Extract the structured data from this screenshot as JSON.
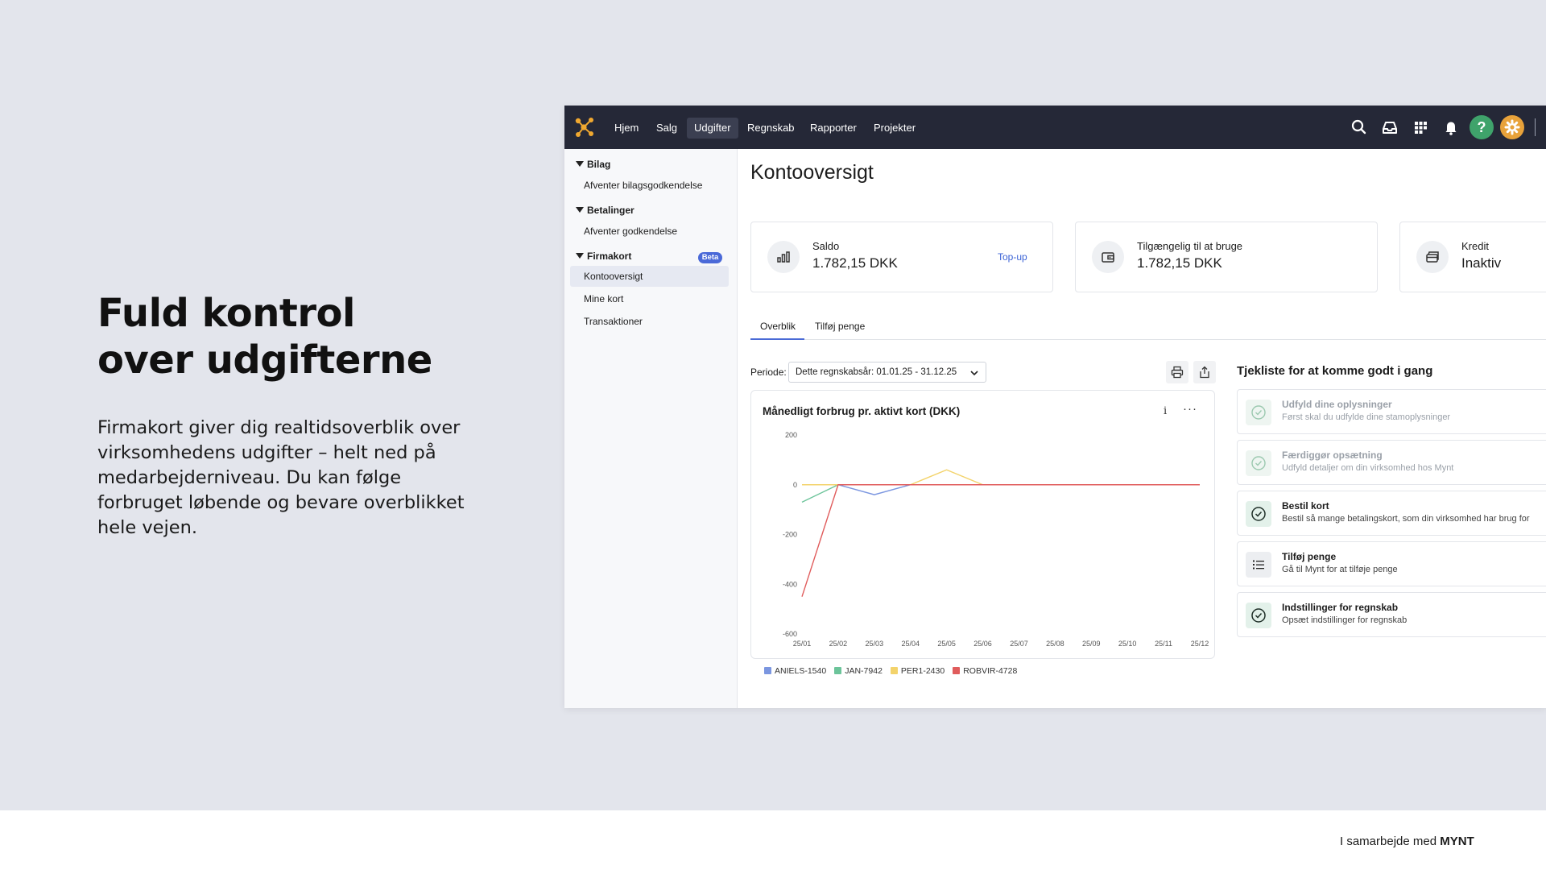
{
  "hero": {
    "title_line1": "Fuld kontrol",
    "title_line2": "over udgifterne",
    "text": "Firmakort giver dig realtidsoverblik over virksomhedens udgifter – helt ned på medarbejderniveau. Du kan følge forbruget løbende og bevare overblikket hele vejen."
  },
  "footer": {
    "prefix": "I samarbejde med",
    "brand": "MYNT"
  },
  "nav": {
    "items": [
      {
        "label": "Hjem",
        "active": false
      },
      {
        "label": "Salg",
        "active": false
      },
      {
        "label": "Udgifter",
        "active": true
      },
      {
        "label": "Regnskab",
        "active": false
      },
      {
        "label": "Rapporter",
        "active": false
      },
      {
        "label": "Projekter",
        "active": false
      }
    ],
    "icons": [
      "search-icon",
      "inbox-icon",
      "apps-grid-icon",
      "bell-icon",
      "help-icon",
      "settings-icon"
    ],
    "colors": {
      "bg": "#252837",
      "help": "#3fa36b",
      "settings": "#e8a23a",
      "logo": "#f0a830"
    }
  },
  "sidebar": {
    "sections": [
      {
        "label": "Bilag",
        "items": [
          "Afventer bilagsgodkendelse"
        ]
      },
      {
        "label": "Betalinger",
        "items": [
          "Afventer godkendelse"
        ]
      },
      {
        "label": "Firmakort",
        "badge": "Beta",
        "items": [
          "Kontooversigt",
          "Mine kort",
          "Transaktioner"
        ],
        "active_item": "Kontooversigt"
      }
    ]
  },
  "main": {
    "title": "Kontooversigt",
    "cards": [
      {
        "label": "Saldo",
        "value": "1.782,15 DKK",
        "link": "Top-up",
        "icon": "bar-chart-icon"
      },
      {
        "label": "Tilgængelig til at bruge",
        "value": "1.782,15 DKK",
        "icon": "wallet-icon"
      },
      {
        "label": "Kredit",
        "value": "Inaktiv",
        "icon": "credit-card-icon"
      }
    ],
    "tabs": [
      "Overblik",
      "Tilføj penge"
    ],
    "active_tab": "Overblik",
    "periode": {
      "label": "Periode:",
      "value": "Dette regnskabsår: 01.01.25 - 31.12.25"
    },
    "chart": {
      "title": "Månedligt forbrug pr. aktivt kort (DKK)",
      "info": "i",
      "more": "···"
    },
    "checklist": {
      "title": "Tjekliste for at komme godt i gang",
      "items": [
        {
          "title": "Udfyld dine oplysninger",
          "sub": "Først skal du udfylde dine stamoplysninger",
          "done": true,
          "icon": "check-circle-icon"
        },
        {
          "title": "Færdiggør opsætning",
          "sub": "Udfyld detaljer om din virksomhed hos Mynt",
          "done": true,
          "icon": "check-circle-icon"
        },
        {
          "title": "Bestil kort",
          "sub": "Bestil så mange betalingskort, som din virksomhed har brug for",
          "done": false,
          "icon": "check-circle-icon"
        },
        {
          "title": "Tilføj penge",
          "sub": "Gå til Mynt for at tilføje penge",
          "done": false,
          "icon": "list-icon"
        },
        {
          "title": "Indstillinger for regnskab",
          "sub": "Opsæt indstillinger for regnskab",
          "done": false,
          "icon": "check-circle-icon"
        }
      ]
    }
  },
  "chart_data": {
    "type": "line",
    "title": "Månedligt forbrug pr. aktivt kort (DKK)",
    "categories": [
      "25/01",
      "25/02",
      "25/03",
      "25/04",
      "25/05",
      "25/06",
      "25/07",
      "25/08",
      "25/09",
      "25/10",
      "25/11",
      "25/12"
    ],
    "yticks": [
      200,
      0,
      -200,
      -400,
      -600
    ],
    "ylim": [
      -600,
      200
    ],
    "series": [
      {
        "name": "ANIELS-1540",
        "color": "#7b96e0",
        "values": [
          0,
          0,
          -40,
          0,
          0,
          0,
          0,
          0,
          0,
          0,
          0,
          0
        ]
      },
      {
        "name": "JAN-7942",
        "color": "#6cc49a",
        "values": [
          -70,
          0,
          0,
          0,
          0,
          0,
          0,
          0,
          0,
          0,
          0,
          0
        ]
      },
      {
        "name": "PER1-2430",
        "color": "#f3d36b",
        "values": [
          0,
          0,
          0,
          0,
          60,
          0,
          0,
          0,
          0,
          0,
          0,
          0
        ]
      },
      {
        "name": "ROBVIR-4728",
        "color": "#e05c5c",
        "values": [
          -450,
          0,
          0,
          0,
          0,
          0,
          0,
          0,
          0,
          0,
          0,
          0
        ]
      }
    ],
    "legend": "bottom-left",
    "grid": false
  }
}
